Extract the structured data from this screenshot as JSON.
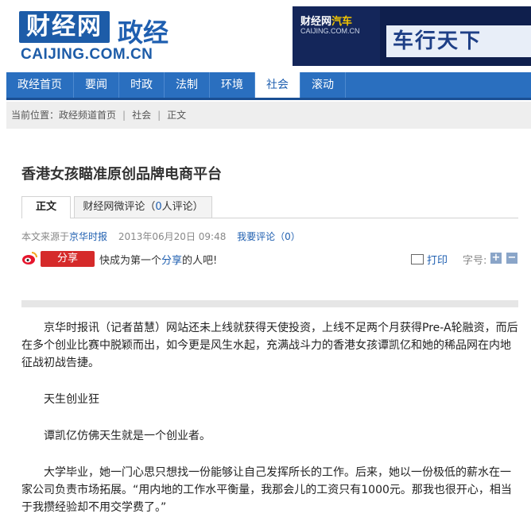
{
  "header": {
    "logo_text": "财经网",
    "section": "政经",
    "domain": "CAIJING.COM.CN",
    "banner": {
      "logo": "财经网",
      "auto": "汽车",
      "domain": "CAIJING.COM.CN",
      "slogan": "车行天下"
    }
  },
  "nav": {
    "items": [
      "政经首页",
      "要闻",
      "时政",
      "法制",
      "环境",
      "社会",
      "滚动"
    ],
    "active": "社会"
  },
  "breadcrumb": {
    "label": "当前位置：",
    "items": [
      "政经频道首页",
      "社会",
      "正文"
    ]
  },
  "article": {
    "title": "香港女孩瞄准原创品牌电商平台",
    "tabs": {
      "body": "正文",
      "comments_prefix": "财经网微评论（",
      "comments_count": "0",
      "comments_suffix": "人评论）"
    },
    "meta": {
      "source_label": "本文来源于",
      "source": "京华时报",
      "date": "2013年06月20日 09:48",
      "comment_link": "我要评论（0）"
    },
    "share": {
      "button": "分享",
      "text_before": "快成为第一个",
      "link": "分享",
      "text_after": "的人吧!",
      "print": "打印",
      "font_label": "字号:",
      "plus": "+",
      "minus": "−"
    },
    "paragraphs": [
      "京华时报讯（记者苗慧）网站还未上线就获得天使投资，上线不足两个月获得Pre-A轮融资，而后在多个创业比赛中脱颖而出，如今更是风生水起，充满战斗力的香港女孩谭凯亿和她的稀品网在内地征战初战告捷。",
      "天生创业狂",
      "谭凯亿仿佛天生就是一个创业者。",
      "大学毕业，她一门心思只想找一份能够让自己发挥所长的工作。后来，她以一份极低的薪水在一家公司负责市场拓展。“用内地的工作水平衡量，我那会儿的工资只有1000元。那我也很开心，相当于我攒经验却不用交学费了。”"
    ]
  }
}
